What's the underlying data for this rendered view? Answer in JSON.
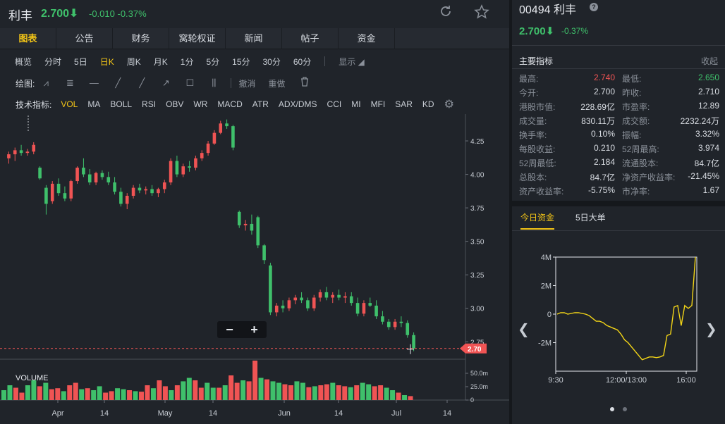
{
  "header": {
    "name": "利丰",
    "price": "2.700⬇",
    "change": "-0.010",
    "change_pct": "-0.37%"
  },
  "tabs": [
    "图表",
    "公告",
    "财务",
    "窝轮权证",
    "新闻",
    "帖子",
    "资金"
  ],
  "periods": [
    "概览",
    "分时",
    "5日",
    "日K",
    "周K",
    "月K",
    "1分",
    "5分",
    "15分",
    "30分",
    "60分"
  ],
  "display_label": "显示",
  "draw": {
    "label": "绘图:",
    "undo": "撤消",
    "redo": "重做"
  },
  "indicators": {
    "label": "技术指标:",
    "items": [
      "VOL",
      "MA",
      "BOLL",
      "RSI",
      "OBV",
      "WR",
      "MACD",
      "ATR",
      "ADX/DMS",
      "CCI",
      "MI",
      "MFI",
      "SAR",
      "KD"
    ]
  },
  "zoom": {
    "minus": "−",
    "plus": "+"
  },
  "colors": {
    "up": "#f05454",
    "down": "#3fc06b",
    "accent": "#f3c517"
  },
  "chart_data": {
    "type": "candlestick",
    "price_ticks": [
      "4.25",
      "4.00",
      "3.75",
      "3.50",
      "3.25",
      "3.00",
      "2.75"
    ],
    "ylim": [
      2.62,
      4.45
    ],
    "last_price_label": "2.70",
    "last_price": 2.7,
    "volume_label": "VOLUME",
    "volume_ticks": [
      "50.0m",
      "25.0m",
      "0"
    ],
    "x_ticks": [
      "Apr",
      "14",
      "May",
      "14",
      "Jun",
      "14",
      "Jul",
      "14"
    ],
    "candles": [
      [
        4.12,
        4.17,
        4.08,
        4.15
      ],
      [
        4.15,
        4.2,
        4.1,
        4.18
      ],
      [
        4.18,
        4.22,
        4.14,
        4.16
      ],
      [
        4.16,
        4.19,
        4.14,
        4.17
      ],
      [
        4.17,
        4.24,
        4.15,
        4.22
      ],
      [
        4.05,
        4.06,
        3.96,
        3.97
      ],
      [
        3.9,
        3.92,
        3.7,
        3.78
      ],
      [
        3.8,
        3.95,
        3.78,
        3.93
      ],
      [
        3.93,
        3.97,
        3.84,
        3.86
      ],
      [
        3.86,
        3.91,
        3.8,
        3.82
      ],
      [
        3.82,
        3.96,
        3.8,
        3.95
      ],
      [
        3.95,
        4.06,
        3.93,
        4.05
      ],
      [
        4.05,
        4.12,
        3.98,
        4.0
      ],
      [
        4.0,
        4.04,
        3.92,
        3.94
      ],
      [
        3.94,
        4.02,
        3.92,
        4.01
      ],
      [
        4.01,
        4.03,
        3.96,
        3.98
      ],
      [
        3.98,
        4.02,
        3.92,
        3.94
      ],
      [
        3.94,
        3.98,
        3.85,
        3.87
      ],
      [
        3.87,
        3.9,
        3.76,
        3.78
      ],
      [
        3.78,
        3.86,
        3.74,
        3.84
      ],
      [
        3.84,
        3.92,
        3.82,
        3.9
      ],
      [
        3.9,
        3.93,
        3.86,
        3.88
      ],
      [
        3.88,
        3.91,
        3.85,
        3.89
      ],
      [
        3.89,
        3.92,
        3.84,
        3.86
      ],
      [
        3.86,
        3.9,
        3.83,
        3.89
      ],
      [
        3.89,
        3.96,
        3.86,
        3.94
      ],
      [
        3.94,
        4.12,
        3.92,
        4.1
      ],
      [
        4.1,
        4.14,
        3.98,
        4.0
      ],
      [
        4.0,
        4.08,
        3.98,
        4.06
      ],
      [
        4.06,
        4.1,
        4.02,
        4.05
      ],
      [
        4.05,
        4.14,
        4.03,
        4.12
      ],
      [
        4.12,
        4.18,
        4.1,
        4.16
      ],
      [
        4.16,
        4.25,
        4.14,
        4.23
      ],
      [
        4.23,
        4.33,
        4.22,
        4.31
      ],
      [
        4.31,
        4.4,
        4.3,
        4.38
      ],
      [
        4.38,
        4.41,
        4.34,
        4.36
      ],
      [
        4.36,
        4.37,
        4.18,
        4.2
      ],
      [
        3.72,
        3.73,
        3.6,
        3.62
      ],
      [
        3.62,
        3.66,
        3.58,
        3.63
      ],
      [
        3.63,
        3.7,
        3.55,
        3.58
      ],
      [
        3.68,
        3.69,
        3.45,
        3.47
      ],
      [
        3.47,
        3.48,
        3.33,
        3.36
      ],
      [
        3.32,
        3.34,
        2.95,
        2.97
      ],
      [
        2.97,
        3.04,
        2.94,
        3.02
      ],
      [
        3.02,
        3.06,
        2.97,
        3.0
      ],
      [
        3.0,
        3.08,
        2.98,
        3.06
      ],
      [
        3.06,
        3.1,
        3.03,
        3.08
      ],
      [
        3.08,
        3.12,
        3.04,
        3.06
      ],
      [
        3.06,
        3.08,
        2.98,
        3.0
      ],
      [
        3.0,
        3.1,
        2.98,
        3.08
      ],
      [
        3.08,
        3.14,
        3.05,
        3.12
      ],
      [
        3.12,
        3.16,
        3.06,
        3.08
      ],
      [
        3.08,
        3.12,
        3.04,
        3.1
      ],
      [
        3.1,
        3.14,
        3.06,
        3.08
      ],
      [
        3.08,
        3.12,
        3.04,
        3.09
      ],
      [
        3.09,
        3.12,
        3.02,
        3.04
      ],
      [
        3.04,
        3.08,
        2.94,
        2.96
      ],
      [
        2.96,
        3.06,
        2.94,
        3.04
      ],
      [
        3.04,
        3.08,
        3.01,
        3.02
      ],
      [
        3.02,
        3.06,
        2.92,
        2.94
      ],
      [
        2.94,
        2.98,
        2.88,
        2.9
      ],
      [
        2.9,
        2.92,
        2.84,
        2.86
      ],
      [
        2.86,
        2.92,
        2.84,
        2.9
      ],
      [
        2.9,
        2.94,
        2.86,
        2.89
      ],
      [
        2.89,
        2.91,
        2.78,
        2.8
      ],
      [
        2.8,
        2.82,
        2.68,
        2.7
      ]
    ],
    "volumes": [
      20,
      30,
      25,
      15,
      30,
      40,
      28,
      35,
      22,
      24,
      18,
      30,
      35,
      22,
      24,
      20,
      28,
      15,
      18,
      24,
      22,
      20,
      18,
      17,
      30,
      24,
      40,
      28,
      20,
      30,
      38,
      45,
      40,
      25,
      35,
      25,
      25,
      30,
      50,
      35,
      40,
      38,
      80,
      45,
      42,
      38,
      35,
      32,
      30,
      38,
      35,
      26,
      28,
      30,
      32,
      35,
      30,
      28,
      26,
      30,
      35,
      32,
      28,
      30,
      25,
      20,
      15,
      10,
      8
    ]
  },
  "right": {
    "code": "00494 利丰",
    "price": "2.700⬇",
    "change_pct": "-0.37%",
    "section_title": "主要指标",
    "collapse": "收起",
    "metrics": [
      [
        [
          "最高:",
          "2.740",
          "red"
        ],
        [
          "最低:",
          "2.650",
          "green"
        ]
      ],
      [
        [
          "今开:",
          "2.700",
          ""
        ],
        [
          "昨收:",
          "2.710",
          ""
        ]
      ],
      [
        [
          "港股市值:",
          "228.69亿",
          ""
        ],
        [
          "市盈率:",
          "12.89",
          ""
        ]
      ],
      [
        [
          "成交量:",
          "830.11万",
          ""
        ],
        [
          "成交额:",
          "2232.24万",
          ""
        ]
      ],
      [
        [
          "换手率:",
          "0.10%",
          ""
        ],
        [
          "振幅:",
          "3.32%",
          ""
        ]
      ],
      [
        [
          "每股收益:",
          "0.210",
          ""
        ],
        [
          "52周最高:",
          "3.974",
          ""
        ]
      ],
      [
        [
          "52周最低:",
          "2.184",
          ""
        ],
        [
          "流通股本:",
          "84.7亿",
          ""
        ]
      ],
      [
        [
          "总股本:",
          "84.7亿",
          ""
        ],
        [
          "净资产收益率:",
          "-21.45%",
          ""
        ]
      ],
      [
        [
          "资产收益率:",
          "-5.75%",
          ""
        ],
        [
          "市净率:",
          "1.67",
          ""
        ]
      ]
    ],
    "tab_today": "今日资金",
    "tab_5day": "5日大单",
    "flow_chart": {
      "type": "line",
      "y_ticks": [
        "4M",
        "2M",
        "0",
        "-2M"
      ],
      "ylim": [
        -4,
        4
      ],
      "x_ticks": [
        "9:30",
        "12:00/13:00",
        "16:00"
      ],
      "series": [
        0.0,
        0.1,
        0.1,
        0.0,
        0.05,
        0.1,
        0.1,
        0.05,
        0.0,
        -0.1,
        -0.3,
        -0.5,
        -0.5,
        -0.6,
        -0.8,
        -0.9,
        -1.0,
        -1.1,
        -1.4,
        -1.8,
        -2.0,
        -2.3,
        -2.6,
        -2.9,
        -3.2,
        -3.1,
        -3.0,
        -3.0,
        -3.05,
        -3.0,
        -2.9,
        -1.5,
        -1.4,
        0.5,
        0.6,
        -0.8,
        0.6,
        0.4,
        0.6,
        4.0
      ]
    }
  }
}
